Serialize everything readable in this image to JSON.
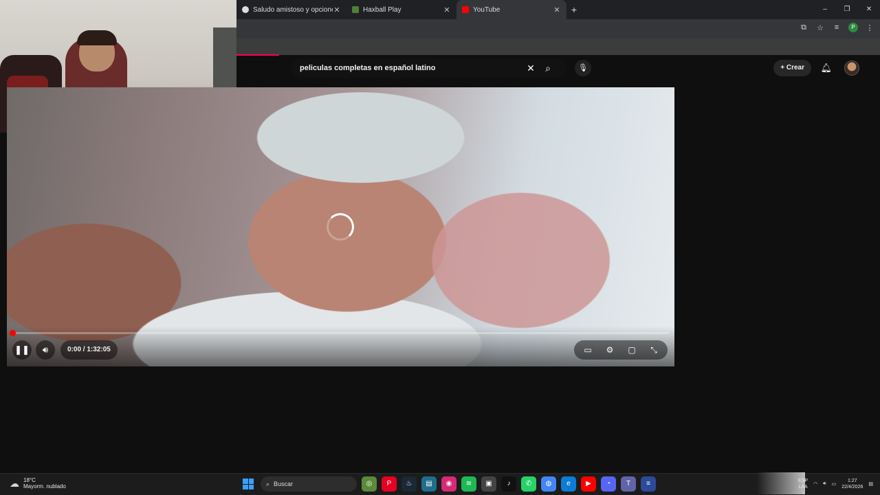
{
  "browser": {
    "tabs": [
      {
        "title": "Saludo amistoso y opciones",
        "favicon_color": "#dadce0"
      },
      {
        "title": "Haxball Play",
        "favicon_color": "#4f7f3a"
      },
      {
        "title": "YouTube",
        "favicon_color": "#ff0000",
        "active": true
      }
    ],
    "newtab_icon": "+",
    "window_controls": {
      "minimize": "–",
      "restore": "❐",
      "close": "✕"
    }
  },
  "youtube": {
    "search_query": "peliculas completas en español latino",
    "create_label": "Crear",
    "player": {
      "time": "0:00 / 1:32:05",
      "progress_fraction": 0.0,
      "state": "loading"
    }
  },
  "taskbar": {
    "weather": {
      "temp": "18°C",
      "desc": "Mayorm. nublado"
    },
    "search_placeholder": "Buscar",
    "lang_line1": "ESP",
    "lang_line2": "LAA",
    "time": "1:27",
    "date": "22/4/2026",
    "apps": [
      {
        "name": "game-icon",
        "color": "#5a8a3a",
        "glyph": "◎"
      },
      {
        "name": "pinterest-icon",
        "color": "#e60023",
        "glyph": "P"
      },
      {
        "name": "steam-icon",
        "color": "#1b2838",
        "glyph": "♨"
      },
      {
        "name": "files-icon",
        "color": "#1f6f8b",
        "glyph": "▤"
      },
      {
        "name": "instagram-icon",
        "color": "#d62976",
        "glyph": "◉"
      },
      {
        "name": "spotify-icon",
        "color": "#1db954",
        "glyph": "≋"
      },
      {
        "name": "app-icon",
        "color": "#444444",
        "glyph": "▣"
      },
      {
        "name": "tiktok-icon",
        "color": "#111111",
        "glyph": "♪"
      },
      {
        "name": "whatsapp-icon",
        "color": "#25d366",
        "glyph": "✆"
      },
      {
        "name": "chrome-icon",
        "color": "#4285f4",
        "glyph": "◍"
      },
      {
        "name": "edge-icon",
        "color": "#0c7cd5",
        "glyph": "e"
      },
      {
        "name": "youtube-icon",
        "color": "#ff0000",
        "glyph": "▶"
      },
      {
        "name": "discord-icon",
        "color": "#5865f2",
        "glyph": "◔"
      },
      {
        "name": "teams-icon",
        "color": "#6264a7",
        "glyph": "T"
      },
      {
        "name": "media-icon",
        "color": "#2c4a9a",
        "glyph": "≡"
      }
    ]
  }
}
